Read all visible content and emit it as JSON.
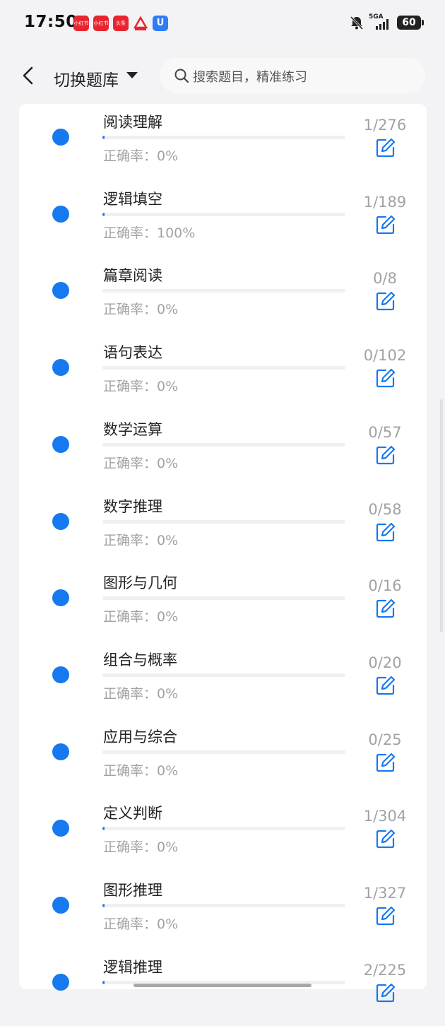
{
  "status_bar": {
    "time": "17:50",
    "app_icons": [
      {
        "name": "app-icon-xiaohongshu-1",
        "label": "小红书",
        "color": "#e8252f"
      },
      {
        "name": "app-icon-xiaohongshu-2",
        "label": "小红书",
        "color": "#e8252f"
      },
      {
        "name": "app-icon-toutiao",
        "label": "头条",
        "color": "#e8252f"
      },
      {
        "name": "app-icon-red-triangle",
        "label": "",
        "color": "#e8252f"
      },
      {
        "name": "app-icon-blue-shield",
        "label": "U",
        "color": "#2e7cf6"
      }
    ],
    "network": "5GA",
    "battery": "60"
  },
  "header": {
    "title": "切换题库",
    "search_placeholder": "搜索题目，精准练习"
  },
  "accent_color": "#1779f0",
  "categories": [
    {
      "name": "阅读理解",
      "accuracy": "正确率：0%",
      "count": "1/276",
      "progress": 0.004
    },
    {
      "name": "逻辑填空",
      "accuracy": "正确率：100%",
      "count": "1/189",
      "progress": 0.005
    },
    {
      "name": "篇章阅读",
      "accuracy": "正确率：0%",
      "count": "0/8",
      "progress": 0
    },
    {
      "name": "语句表达",
      "accuracy": "正确率：0%",
      "count": "0/102",
      "progress": 0
    },
    {
      "name": "数学运算",
      "accuracy": "正确率：0%",
      "count": "0/57",
      "progress": 0
    },
    {
      "name": "数字推理",
      "accuracy": "正确率：0%",
      "count": "0/58",
      "progress": 0
    },
    {
      "name": "图形与几何",
      "accuracy": "正确率：0%",
      "count": "0/16",
      "progress": 0
    },
    {
      "name": "组合与概率",
      "accuracy": "正确率：0%",
      "count": "0/20",
      "progress": 0
    },
    {
      "name": "应用与综合",
      "accuracy": "正确率：0%",
      "count": "0/25",
      "progress": 0
    },
    {
      "name": "定义判断",
      "accuracy": "正确率：0%",
      "count": "1/304",
      "progress": 0.003
    },
    {
      "name": "图形推理",
      "accuracy": "正确率：0%",
      "count": "1/327",
      "progress": 0.003
    },
    {
      "name": "逻辑推理",
      "accuracy": "",
      "count": "2/225",
      "progress": 0.009
    }
  ]
}
